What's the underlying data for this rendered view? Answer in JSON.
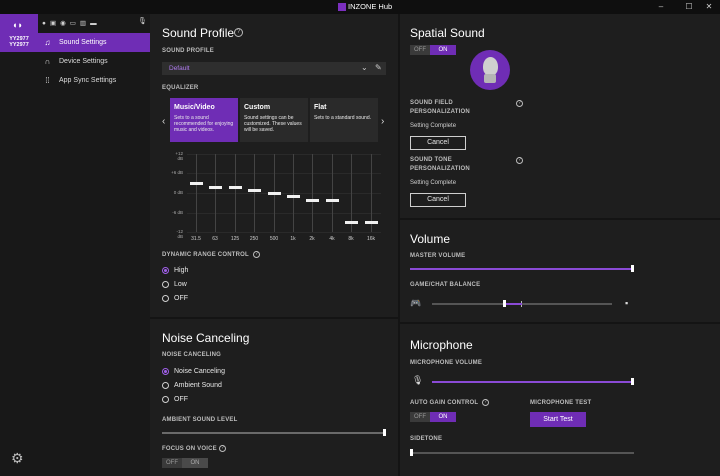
{
  "app": {
    "title": "INZONE Hub"
  },
  "window": {
    "minimize": "–",
    "maximize": "☐",
    "close": "✕"
  },
  "device": {
    "name_line1": "YY2977",
    "name_line2": "YY2977"
  },
  "sidebar": {
    "items": [
      {
        "label": "Sound Settings",
        "icon": "music-note-icon"
      },
      {
        "label": "Device Settings",
        "icon": "headphones-icon"
      },
      {
        "label": "App Sync Settings",
        "icon": "grid-icon"
      }
    ]
  },
  "sound_profile": {
    "title": "Sound Profile",
    "profile_label": "SOUND PROFILE",
    "profile_value": "Default",
    "equalizer_label": "EQUALIZER",
    "cards": [
      {
        "name": "Music/Video",
        "desc": "Sets to a sound recommended for enjoying music and videos."
      },
      {
        "name": "Custom",
        "desc": "Sound settings can be customized. These values will be saved."
      },
      {
        "name": "Flat",
        "desc": "Sets to a standard sound."
      }
    ],
    "db_labels": [
      "+12 dB",
      "+6 dB",
      "0 dB",
      "-6 dB",
      "-12 dB"
    ],
    "bands": [
      {
        "freq": "31.5",
        "db": 3
      },
      {
        "freq": "63",
        "db": 2
      },
      {
        "freq": "125",
        "db": 2
      },
      {
        "freq": "250",
        "db": 1
      },
      {
        "freq": "500",
        "db": 0
      },
      {
        "freq": "1k",
        "db": -1
      },
      {
        "freq": "2k",
        "db": -2
      },
      {
        "freq": "4k",
        "db": -2
      },
      {
        "freq": "8k",
        "db": -9
      },
      {
        "freq": "16k",
        "db": -9
      }
    ],
    "drc_label": "DYNAMIC RANGE CONTROL",
    "drc_options": [
      "High",
      "Low",
      "OFF"
    ],
    "drc_selected": "High"
  },
  "noise_canceling": {
    "title": "Noise Canceling",
    "label": "NOISE CANCELING",
    "options": [
      "Noise Canceling",
      "Ambient Sound",
      "OFF"
    ],
    "selected": "Noise Canceling",
    "ambient_label": "AMBIENT SOUND LEVEL",
    "ambient_level": 1.0,
    "focus_label": "FOCUS ON VOICE",
    "focus_off": "OFF",
    "focus_on": "ON"
  },
  "spatial_sound": {
    "title": "Spatial Sound",
    "toggle_off": "OFF",
    "toggle_on": "ON",
    "field_label_1": "SOUND FIELD",
    "field_label_2": "PERSONALIZATION",
    "field_status": "Setting Complete",
    "field_cancel": "Cancel",
    "tone_label_1": "SOUND TONE",
    "tone_label_2": "PERSONALIZATION",
    "tone_status": "Setting Complete",
    "tone_cancel": "Cancel"
  },
  "volume": {
    "title": "Volume",
    "master_label": "MASTER VOLUME",
    "master_level": 1.0,
    "balance_label": "GAME/CHAT BALANCE",
    "balance_level": 0.4
  },
  "microphone": {
    "title": "Microphone",
    "volume_label": "MICROPHONE VOLUME",
    "volume_level": 1.0,
    "agc_label": "AUTO GAIN CONTROL",
    "agc_off": "OFF",
    "agc_on": "ON",
    "test_label": "MICROPHONE TEST",
    "test_button": "Start Test",
    "sidetone_label": "SIDETONE",
    "sidetone_level": 0.0
  },
  "colors": {
    "accent": "#6f2db5",
    "accent_light": "#a060ea",
    "panel": "#1e1e1e",
    "background": "#141414"
  }
}
